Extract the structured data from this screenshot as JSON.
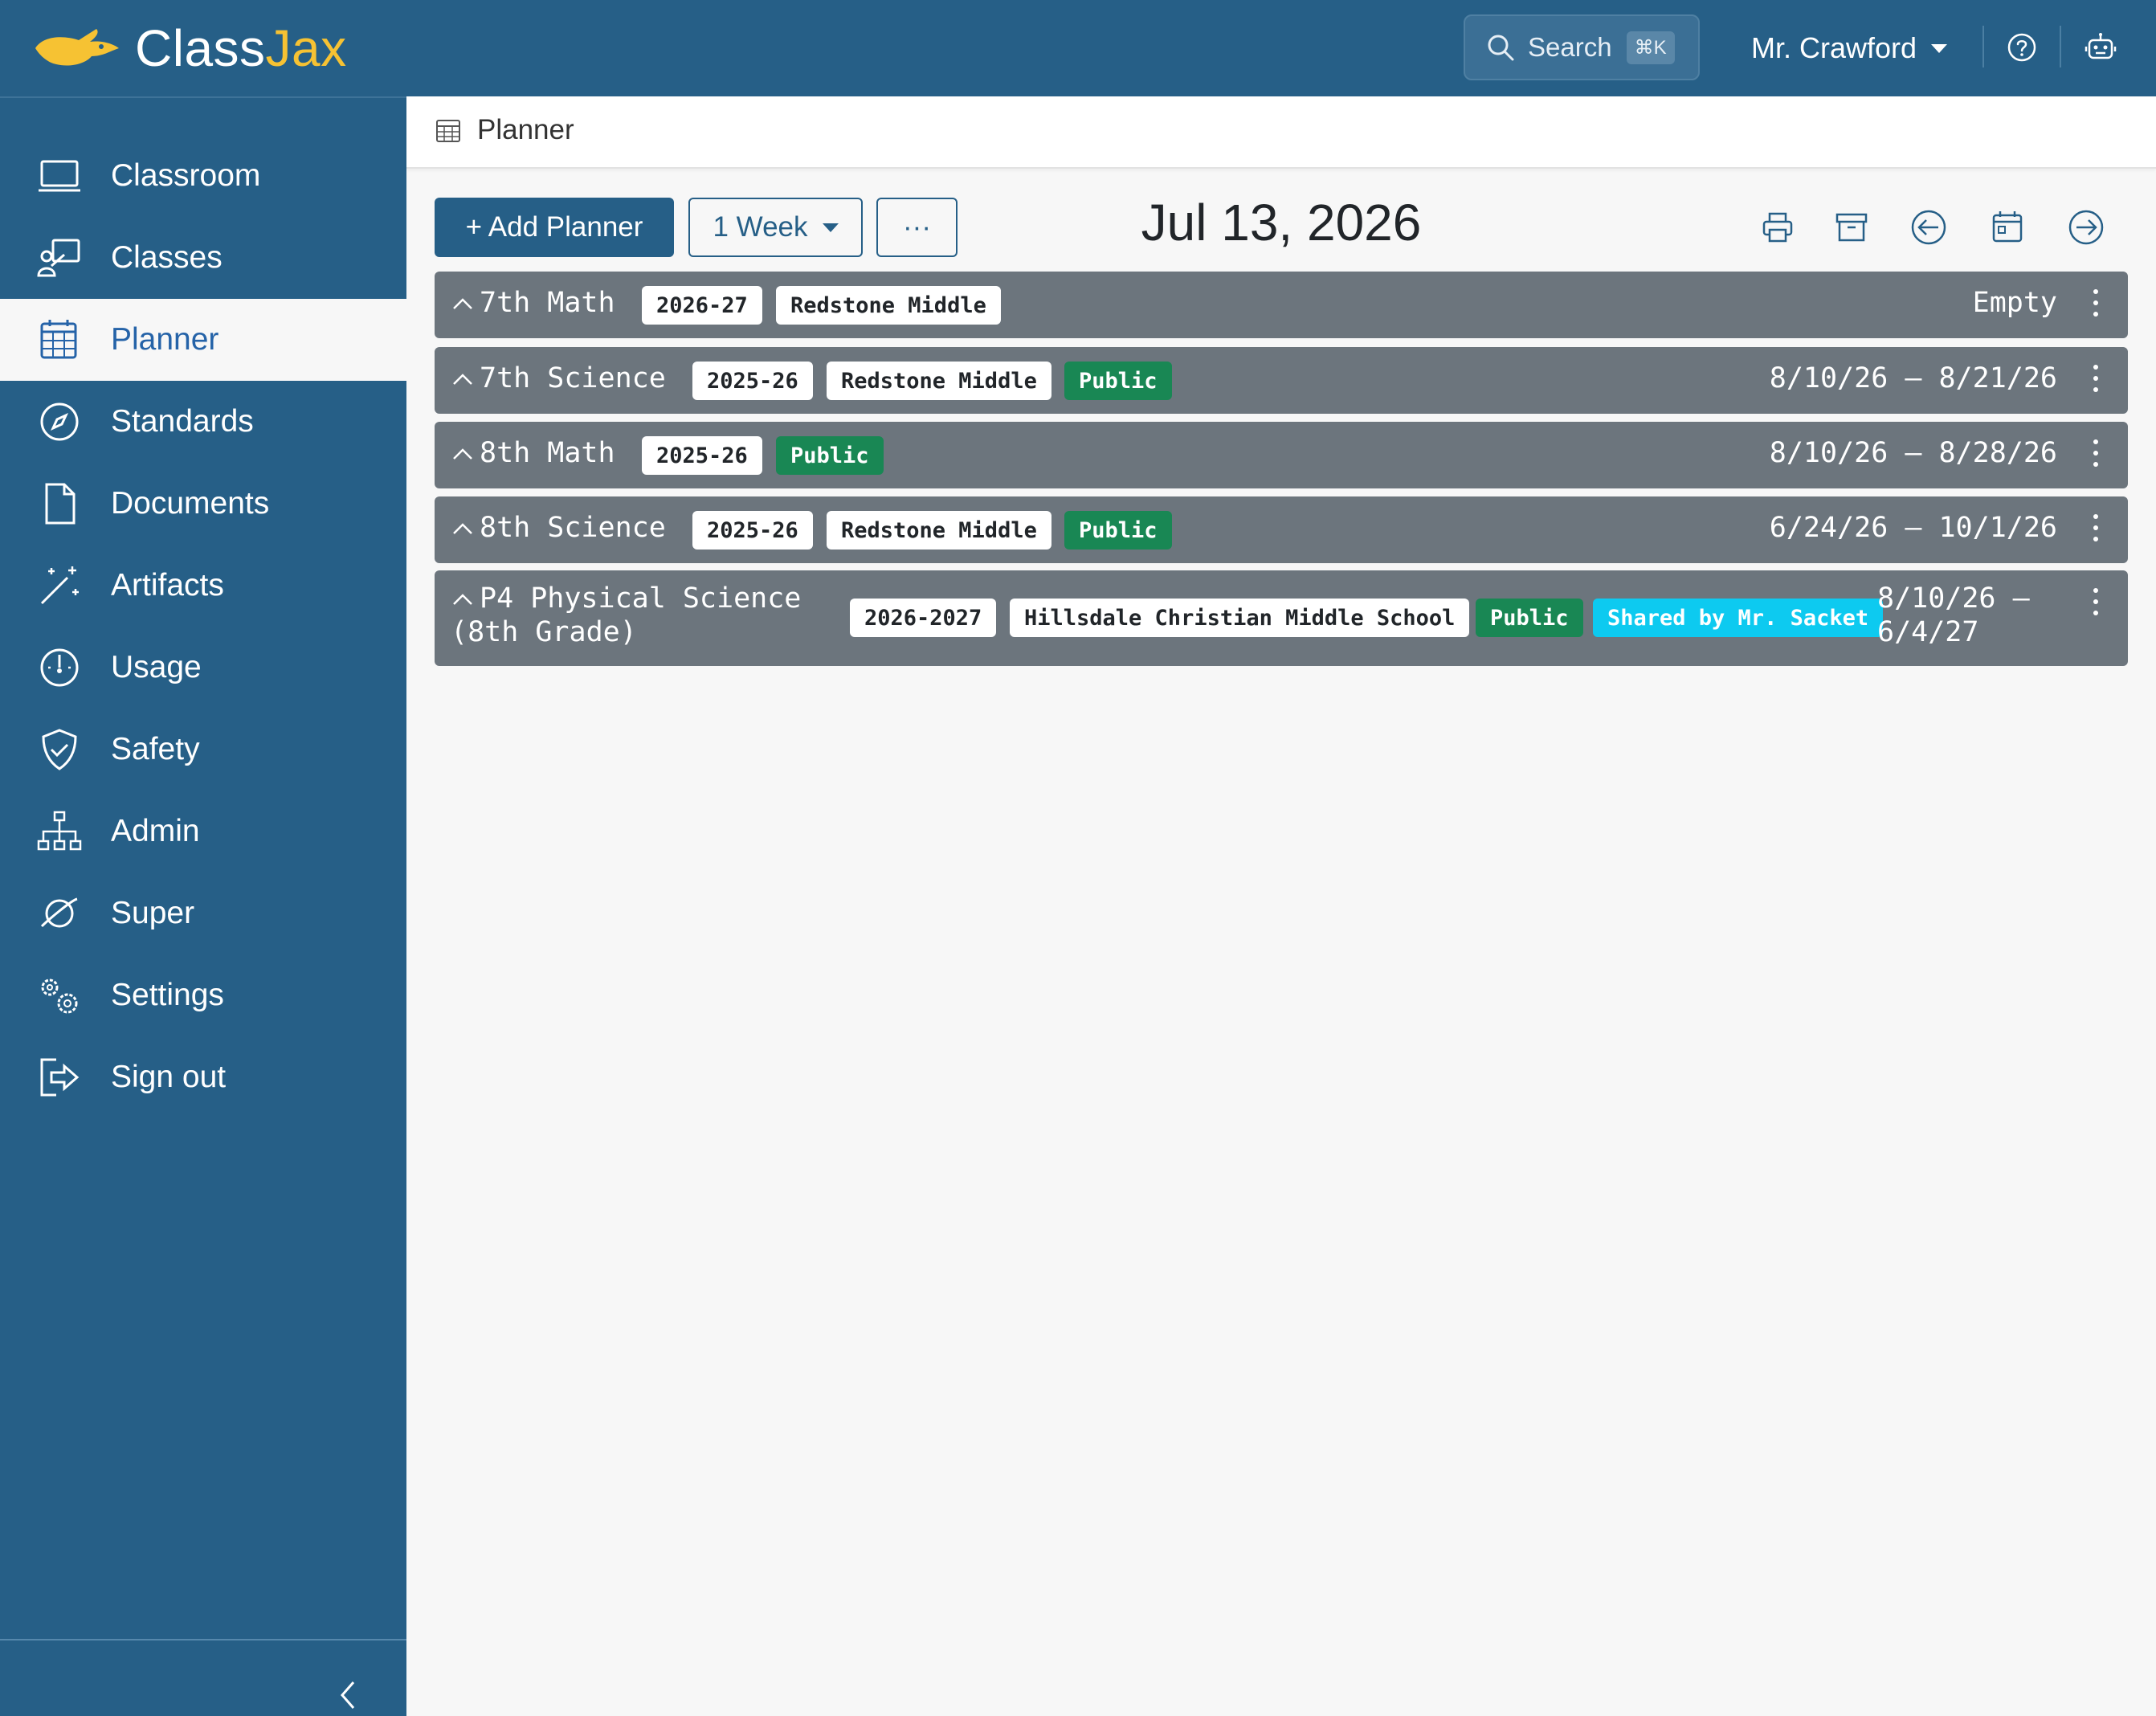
{
  "brand": {
    "name_part1": "Class",
    "name_part2": "Jax",
    "accent_color": "#f6c233",
    "primary_color": "#265f87"
  },
  "topbar": {
    "search_label": "Search",
    "search_shortcut": "⌘K",
    "user_name": "Mr. Crawford",
    "icons": [
      "search-icon",
      "help-icon",
      "robot-icon"
    ]
  },
  "sidebar": {
    "items": [
      {
        "label": "Classroom",
        "icon": "laptop-icon"
      },
      {
        "label": "Classes",
        "icon": "teacher-board-icon"
      },
      {
        "label": "Planner",
        "icon": "calendar-grid-icon",
        "active": true
      },
      {
        "label": "Standards",
        "icon": "compass-icon"
      },
      {
        "label": "Documents",
        "icon": "document-icon"
      },
      {
        "label": "Artifacts",
        "icon": "magic-wand-icon"
      },
      {
        "label": "Usage",
        "icon": "speedometer-icon"
      },
      {
        "label": "Safety",
        "icon": "shield-check-icon"
      },
      {
        "label": "Admin",
        "icon": "org-chart-icon"
      },
      {
        "label": "Super",
        "icon": "orbit-icon"
      },
      {
        "label": "Settings",
        "icon": "gears-icon"
      },
      {
        "label": "Sign out",
        "icon": "sign-out-icon"
      }
    ]
  },
  "breadcrumb": {
    "label": "Planner"
  },
  "toolbar": {
    "add_planner_label": "+ Add Planner",
    "range_label": "1 Week",
    "more_label": "···",
    "date": "Jul 13, 2026"
  },
  "planners": [
    {
      "title": "7th Math",
      "badges": [
        {
          "text": "2026-27",
          "style": "light"
        },
        {
          "text": "Redstone Middle",
          "style": "light"
        }
      ],
      "dates": "Empty"
    },
    {
      "title": "7th Science",
      "badges": [
        {
          "text": "2025-26",
          "style": "light"
        },
        {
          "text": "Redstone Middle",
          "style": "light"
        },
        {
          "text": "Public",
          "style": "green"
        }
      ],
      "dates": "8/10/26 – 8/21/26"
    },
    {
      "title": "8th Math",
      "badges": [
        {
          "text": "2025-26",
          "style": "light"
        },
        {
          "text": "Public",
          "style": "green"
        }
      ],
      "dates": "8/10/26 – 8/28/26"
    },
    {
      "title": "8th Science",
      "badges": [
        {
          "text": "2025-26",
          "style": "light"
        },
        {
          "text": "Redstone Middle",
          "style": "light"
        },
        {
          "text": "Public",
          "style": "green"
        }
      ],
      "dates": "6/24/26 – 10/1/26"
    },
    {
      "title_line1": "P4 Physical Science",
      "title_line2": "(8th Grade)",
      "badges": [
        {
          "text": "2026-2027",
          "style": "light"
        },
        {
          "text": "Hillsdale Christian Middle School",
          "style": "light"
        },
        {
          "text": "Public",
          "style": "green"
        },
        {
          "text": "Shared by Mr. Sacket",
          "style": "cyan"
        }
      ],
      "dates_line1": "8/10/26 –",
      "dates_line2": "6/4/27"
    }
  ]
}
